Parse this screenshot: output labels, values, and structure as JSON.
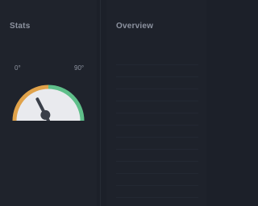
{
  "left_panel": {
    "title": "Stats",
    "gauge": {
      "min_label": "0°",
      "max_label": "90°",
      "value_fraction": 0.35,
      "accent": "#e0a24a",
      "track": "#d9dbe0"
    },
    "rows": [
      {
        "label": "",
        "value": ""
      },
      {
        "label": "",
        "value": ""
      },
      {
        "label": "",
        "value": ""
      },
      {
        "label": "",
        "value": ""
      },
      {
        "label": "",
        "value": ""
      }
    ]
  },
  "right_panel": {
    "title": "Overview",
    "rows": [
      {
        "a": "",
        "b": "",
        "c": ""
      },
      {
        "a": "",
        "b": "",
        "c": ""
      },
      {
        "a": "",
        "b": "",
        "c": ""
      },
      {
        "a": "",
        "b": "",
        "c": ""
      },
      {
        "a": "",
        "b": "",
        "c": ""
      },
      {
        "a": "",
        "b": "",
        "c": ""
      },
      {
        "a": "",
        "b": "",
        "c": ""
      },
      {
        "a": "",
        "b": "",
        "c": ""
      },
      {
        "a": "",
        "b": "",
        "c": ""
      },
      {
        "a": "",
        "b": "",
        "c": ""
      },
      {
        "a": "",
        "b": "",
        "c": ""
      },
      {
        "a": "",
        "b": "",
        "c": ""
      }
    ]
  },
  "colors": {
    "bg": "#1c2029",
    "accent_green": "#5fbf8a",
    "accent_teal": "#2f7a6a"
  }
}
